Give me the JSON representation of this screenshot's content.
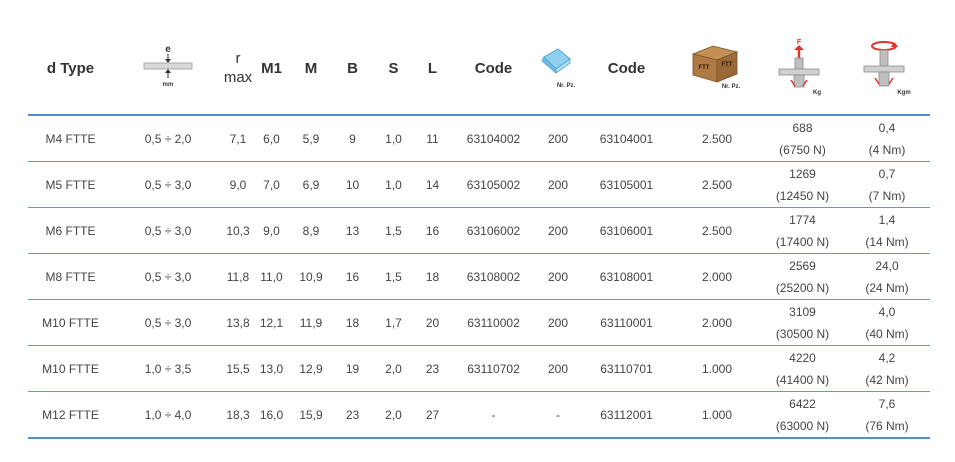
{
  "header": {
    "type": "d Type",
    "gauge_top": "e",
    "gauge_bottom": "mm",
    "r_top": "r",
    "r_bottom": "max",
    "m1": "M1",
    "m": "M",
    "b": "B",
    "s": "S",
    "l": "L",
    "code1": "Code",
    "bag_label": "Nr. Pz.",
    "code2": "Code",
    "box_label": "Nr. Pz.",
    "box_print": "FTT",
    "pull_top": "F",
    "pull_label": "Kg",
    "torque_label": "Kgm"
  },
  "rows": [
    {
      "type": "M4 FTTE",
      "e": "0,5 ÷ 2,0",
      "r": "7,1",
      "m1": "6,0",
      "m": "5,9",
      "b": "9",
      "s": "1,0",
      "l": "11",
      "code1": "63104002",
      "qty1": "200",
      "code2": "63104001",
      "qty2": "2.500",
      "pull": "688",
      "pull_n": "(6750 N)",
      "torque": "0,4",
      "torque_nm": "(4 Nm)"
    },
    {
      "type": "M5 FTTE",
      "e": "0,5 ÷ 3,0",
      "r": "9,0",
      "m1": "7,0",
      "m": "6,9",
      "b": "10",
      "s": "1,0",
      "l": "14",
      "code1": "63105002",
      "qty1": "200",
      "code2": "63105001",
      "qty2": "2.500",
      "pull": "1269",
      "pull_n": "(12450 N)",
      "torque": "0,7",
      "torque_nm": "(7 Nm)"
    },
    {
      "type": "M6 FTTE",
      "e": "0,5 ÷ 3,0",
      "r": "10,3",
      "m1": "9,0",
      "m": "8,9",
      "b": "13",
      "s": "1,5",
      "l": "16",
      "code1": "63106002",
      "qty1": "200",
      "code2": "63106001",
      "qty2": "2.500",
      "pull": "1774",
      "pull_n": "(17400 N)",
      "torque": "1,4",
      "torque_nm": "(14 Nm)"
    },
    {
      "type": "M8 FTTE",
      "e": "0,5 ÷ 3,0",
      "r": "11,8",
      "m1": "11,0",
      "m": "10,9",
      "b": "16",
      "s": "1,5",
      "l": "18",
      "code1": "63108002",
      "qty1": "200",
      "code2": "63108001",
      "qty2": "2.000",
      "pull": "2569",
      "pull_n": "(25200 N)",
      "torque": "24,0",
      "torque_nm": "(24 Nm)"
    },
    {
      "type": "M10 FTTE",
      "e": "0,5 ÷ 3,0",
      "r": "13,8",
      "m1": "12,1",
      "m": "11,9",
      "b": "18",
      "s": "1,7",
      "l": "20",
      "code1": "63110002",
      "qty1": "200",
      "code2": "63110001",
      "qty2": "2.000",
      "pull": "3109",
      "pull_n": "(30500 N)",
      "torque": "4,0",
      "torque_nm": "(40 Nm)"
    },
    {
      "type": "M10 FTTE",
      "e": "1,0 ÷ 3,5",
      "r": "15,5",
      "m1": "13,0",
      "m": "12,9",
      "b": "19",
      "s": "2,0",
      "l": "23",
      "code1": "63110702",
      "qty1": "200",
      "code2": "63110701",
      "qty2": "1.000",
      "pull": "4220",
      "pull_n": "(41400 N)",
      "torque": "4,2",
      "torque_nm": "(42 Nm)"
    },
    {
      "type": "M12 FTTE",
      "e": "1,0 ÷ 4,0",
      "r": "18,3",
      "m1": "16,0",
      "m": "15,9",
      "b": "23",
      "s": "2,0",
      "l": "27",
      "code1": "-",
      "qty1": "-",
      "code2": "63112001",
      "qty2": "1.000",
      "pull": "6422",
      "pull_n": "(63000 N)",
      "torque": "7,6",
      "torque_nm": "(76 Nm)"
    }
  ],
  "colors": {
    "rule": "#4f8fcc",
    "text": "#444444",
    "arrow": "#e0342b",
    "box": "#b07a44",
    "bag": "#8fd0ef"
  }
}
